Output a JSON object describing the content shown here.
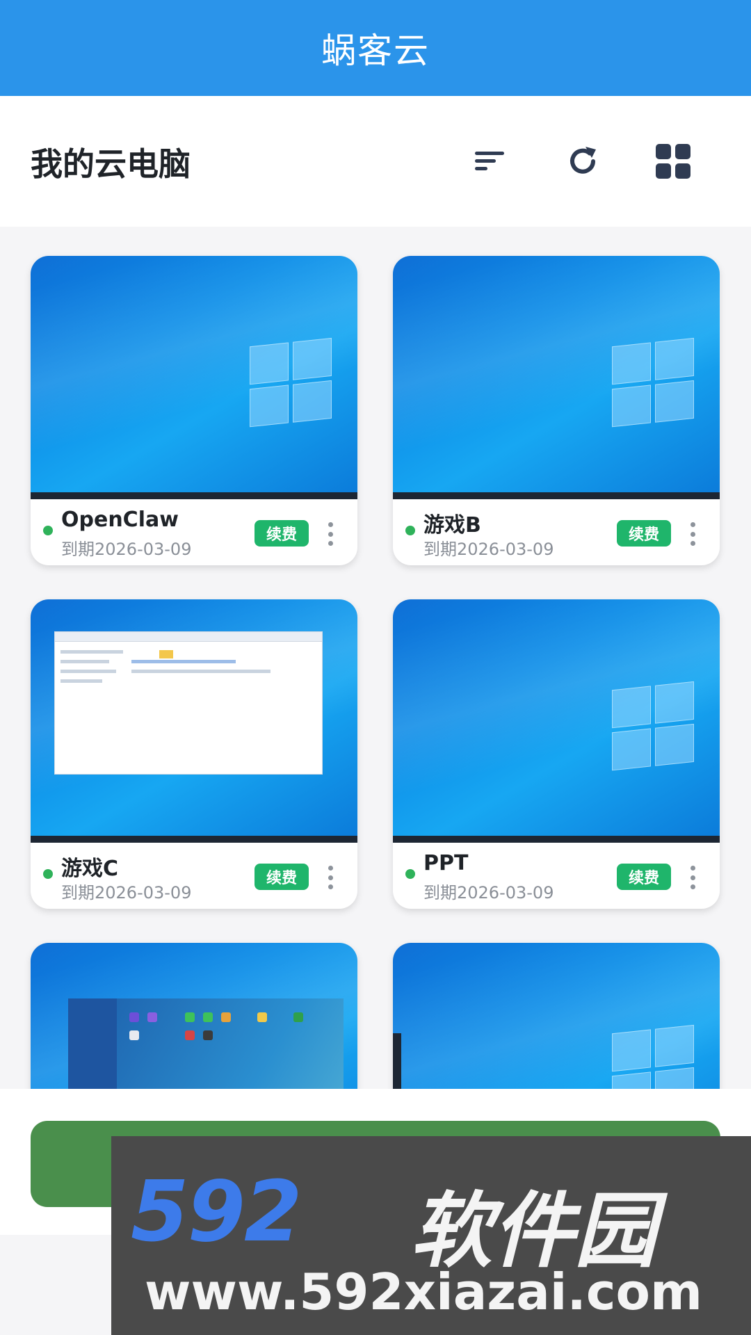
{
  "app": {
    "title": "蜗客云"
  },
  "header": {
    "title": "我的云电脑",
    "icons": [
      "sort-icon",
      "refresh-icon",
      "grid-view-icon"
    ]
  },
  "computers": [
    {
      "name": "OpenClaw",
      "expiry": "到期2026-03-09",
      "renew_label": "续费",
      "status": "online",
      "screen": "desktop"
    },
    {
      "name": "游戏B",
      "expiry": "到期2026-03-09",
      "renew_label": "续费",
      "status": "online",
      "screen": "desktop"
    },
    {
      "name": "游戏C",
      "expiry": "到期2026-03-09",
      "renew_label": "续费",
      "status": "online",
      "screen": "file-explorer"
    },
    {
      "name": "PPT",
      "expiry": "到期2026-03-09",
      "renew_label": "续费",
      "status": "online",
      "screen": "desktop"
    },
    {
      "screen": "desktop-app"
    },
    {
      "screen": "desktop"
    }
  ],
  "colors": {
    "topbar": "#2b94ea",
    "renew": "#1fb56b",
    "online": "#2fb25a",
    "primary_button": "#4a8f4c"
  },
  "watermark": {
    "brand": "592",
    "brand_cn": "软件园",
    "url": "www.592xiazai.com"
  }
}
